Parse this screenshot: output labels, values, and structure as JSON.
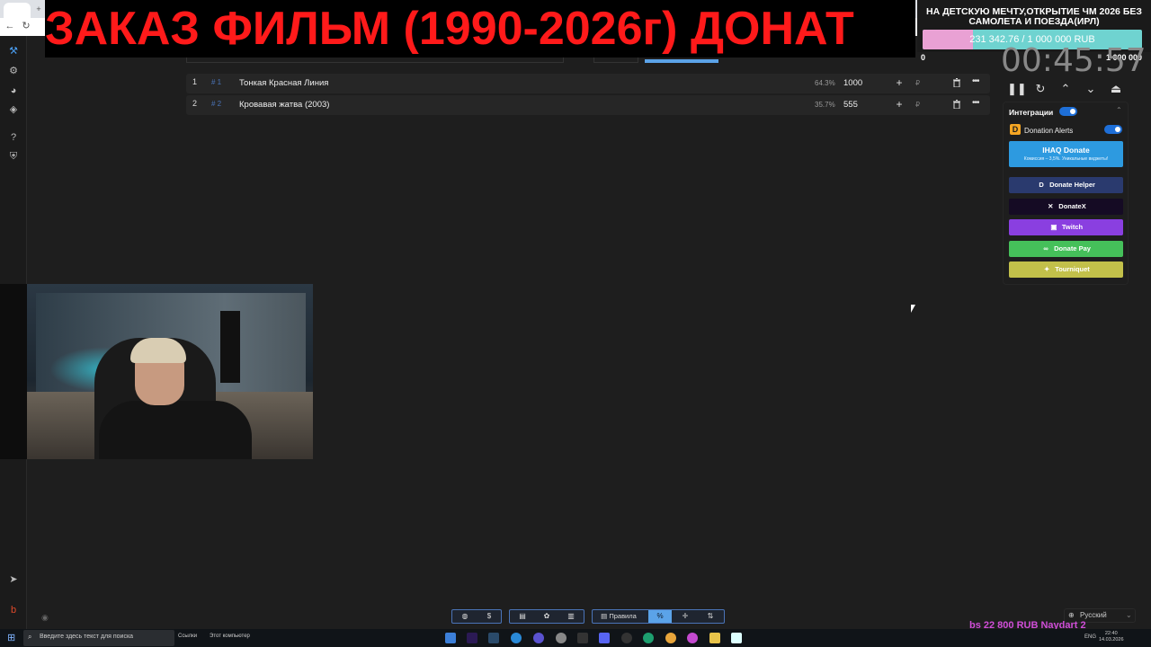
{
  "overlay": {
    "title": "ЗАКАЗ ФИЛЬМ (1990-2026г) ДОНАТ"
  },
  "goal": {
    "title": "НА ДЕТСКУЮ МЕЧТУ,ОТКРЫТИЕ ЧМ 2026 БЕЗ САМОЛЕТА И ПОЕЗДА(ИРЛ)",
    "amount": "231 342.76 / 1 000 000 RUB",
    "progress": 0.231,
    "min": "0",
    "max": "1 000 000",
    "fill_color": "#e9a1d4",
    "track_color": "#6fd3d0"
  },
  "timer": {
    "value": "00:45:57",
    "controls": [
      "pause-icon",
      "restart-icon",
      "chevron-up-icon",
      "chevron-down-icon",
      "collapse-up-icon"
    ]
  },
  "lots": [
    {
      "num": "1",
      "id": "# 1",
      "name": "Тонкая Красная Линия",
      "pct": "64.3%",
      "amount": "1000",
      "currency": "₽"
    },
    {
      "num": "2",
      "id": "# 2",
      "name": "Кровавая жатва (2003)",
      "pct": "35.7%",
      "amount": "555",
      "currency": "₽"
    }
  ],
  "integrations": {
    "title": "Интеграции",
    "donation_alerts": "Donation Alerts",
    "services": {
      "ihaq": {
        "name": "IHAQ Donate",
        "sub": "Комиссия – 3,5%. Уникальные виджеты!"
      },
      "donate_helper": "Donate Helper",
      "donatex": "DonateX",
      "twitch": "Twitch",
      "donate_pay": "Donate Pay",
      "tourniquet": "Tourniquet"
    },
    "colors": {
      "ihaq": "#2d9ae0",
      "donate_helper": "#2a3a6e",
      "donatex": "#150b24",
      "twitch": "#8a3fe0",
      "donate_pay": "#45c05a",
      "tourniquet": "#c2c04a"
    }
  },
  "bottom_toolbar": {
    "rules_label": "Правила",
    "pct_label": "%"
  },
  "language": {
    "selected": "Русский"
  },
  "ticker": {
    "text": "bs 22 800 RUB Naydart 2"
  },
  "taskbar": {
    "search_placeholder": "Введите здесь текст для поиска",
    "links_label": "Ссылки",
    "pc_label": "Этот компьютер",
    "lang": "ENG",
    "time": "22:40",
    "date": "14.03.2026"
  }
}
